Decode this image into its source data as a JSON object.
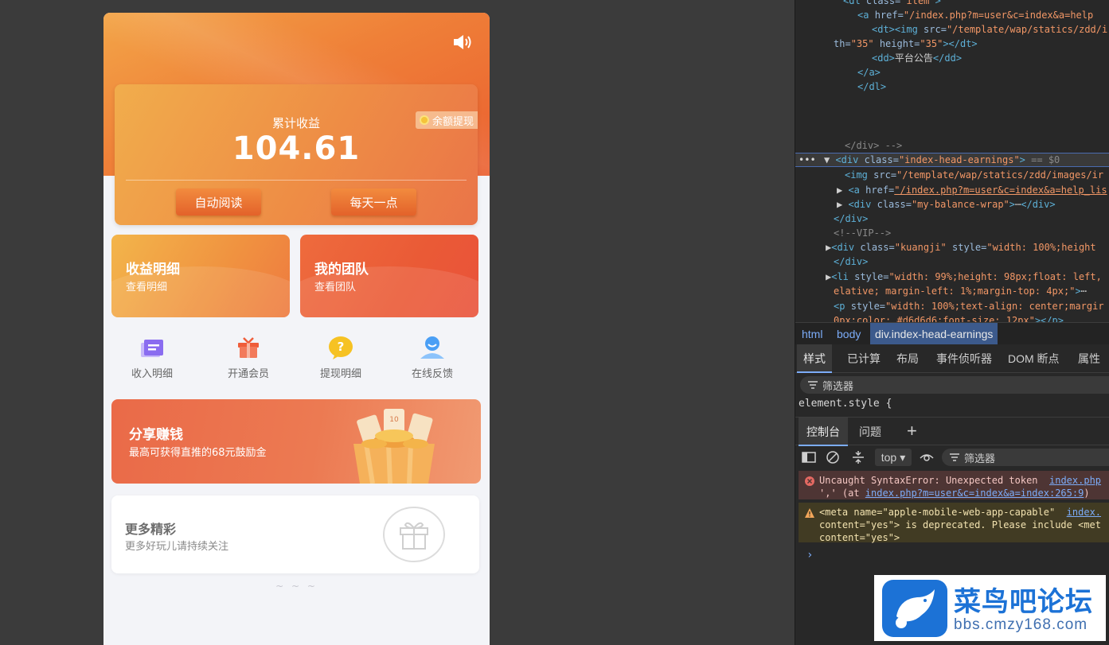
{
  "app": {
    "speaker_icon": "speaker-icon",
    "earnings": {
      "label": "累计收益",
      "value": "104.61",
      "withdraw_label": "余额提现"
    },
    "actions": [
      {
        "label": "自动阅读"
      },
      {
        "label": "每天一点"
      }
    ],
    "tiles": [
      {
        "title": "收益明细",
        "subtitle": "查看明细"
      },
      {
        "title": "我的团队",
        "subtitle": "查看团队"
      }
    ],
    "quick_links": [
      {
        "label": "收入明细",
        "icon": "document-icon",
        "color": "#8a6cf0"
      },
      {
        "label": "开通会员",
        "icon": "gift-box-icon",
        "color": "#ef5d3a"
      },
      {
        "label": "提现明细",
        "icon": "question-bubble-icon",
        "color": "#f6c223"
      },
      {
        "label": "在线反馈",
        "icon": "user-icon",
        "color": "#4a9ff5"
      }
    ],
    "share": {
      "title": "分享赚钱",
      "subtitle": "最高可获得直推的68元鼓励金",
      "ticket_label": "10"
    },
    "more": {
      "title": "更多精彩",
      "subtitle": "更多好玩儿请持续关注"
    },
    "footer_mark": "~ ~ ~"
  },
  "devtools": {
    "dom_lines": [
      {
        "indent": 60,
        "html": "<span class='tag'>&lt;dl</span> <span class='attr'>class=</span><span class='val'>\"item\"</span><span class='tag'>&gt;</span>"
      },
      {
        "indent": 78,
        "html": "<span class='tag'>&lt;a</span> <span class='attr'>href=</span><span class='val'>\"/index.php?m=user&amp;c=index&amp;a=help</span>"
      },
      {
        "indent": 96,
        "html": "<span class='tag'>&lt;dt&gt;&lt;img</span> <span class='attr'>src=</span><span class='val'>\"/template/wap/statics/zdd/i</span>"
      },
      {
        "indent": 48,
        "html": "<span class='attr'>th=</span><span class='val'>\"35\"</span> <span class='attr'>height=</span><span class='val'>\"35\"</span><span class='tag'>&gt;&lt;/dt&gt;</span>"
      },
      {
        "indent": 96,
        "html": "<span class='tag'>&lt;dd&gt;</span><span class='txt'>平台公告</span><span class='tag'>&lt;/dd&gt;</span>"
      },
      {
        "indent": 78,
        "html": "<span class='tag'>&lt;/a&gt;</span>"
      },
      {
        "indent": 78,
        "html": "<span class='tag'>&lt;/dl&gt;</span>"
      },
      {
        "indent": 62,
        "html": "<span class='cmt'>&lt;/div&gt; --&gt;</span>"
      },
      {
        "indent": 36,
        "html": "<span class='txt'>▼ </span><span class='tag'>&lt;div</span> <span class='attr'>class=</span><span class='val'>\"index-head-earnings\"</span><span class='tag'>&gt;</span> <span class='cmt'>== $0</span>"
      },
      {
        "indent": 62,
        "html": "<span class='tag'>&lt;img</span> <span class='attr'>src=</span><span class='val'>\"/template/wap/statics/zdd/images/ir</span>"
      },
      {
        "indent": 52,
        "html": "<span class='txt'>▶ </span><span class='tag'>&lt;a</span> <span class='attr'>href=</span><span class='link'>\"/index.php?m=user&amp;c=index&amp;a=help_lis</span>"
      },
      {
        "indent": 52,
        "html": "<span class='txt'>▶ </span><span class='tag'>&lt;div</span> <span class='attr'>class=</span><span class='val'>\"my-balance-wrap\"</span><span class='tag'>&gt;</span><span class='txt'>⋯</span><span class='tag'>&lt;/div&gt;</span>"
      },
      {
        "indent": 48,
        "html": "<span class='tag'>&lt;/div&gt;</span>"
      },
      {
        "indent": 48,
        "html": "<span class='cmt'>&lt;!--VIP--&gt;</span>"
      },
      {
        "indent": 38,
        "html": "<span class='txt'>▶</span><span class='tag'>&lt;div</span> <span class='attr'>class=</span><span class='val'>\"kuangji\"</span> <span class='attr'>style=</span><span class='val'>\"width: 100%;height</span>"
      },
      {
        "indent": 48,
        "html": "<span class='tag'>&lt;/div&gt;</span>"
      },
      {
        "indent": 38,
        "html": "<span class='txt'>▶</span><span class='tag'>&lt;li</span> <span class='attr'>style=</span><span class='val'>\"width: 99%;height: 98px;float: left,</span>"
      },
      {
        "indent": 48,
        "html": "<span class='val'>elative; margin-left: 1%;margin-top: 4px;\"</span><span class='tag'>&gt;</span><span class='txt'>⋯</span>"
      },
      {
        "indent": 48,
        "html": "<span class='tag'>&lt;p</span> <span class='attr'>style=</span><span class='val'>\"width: 100%;text-align: center;margir</span>"
      },
      {
        "indent": 48,
        "html": "<span class='val'>0px;color: #d6d6d6;font-size: 12px\"</span><span class='tag'>&gt;&lt;/p&gt;</span>"
      }
    ],
    "breadcrumbs": [
      "html",
      "body",
      "div.index-head-earnings"
    ],
    "panel_tabs": [
      "样式",
      "已计算",
      "布局",
      "事件侦听器",
      "DOM 断点",
      "属性"
    ],
    "filter_placeholder": "筛选器",
    "element_style": "element.style {",
    "console_tabs": [
      "控制台",
      "问题"
    ],
    "console_context": "top",
    "console_filter": "筛选器",
    "messages": [
      {
        "type": "error",
        "text1": "Uncaught SyntaxError: Unexpected token",
        "text2": "',' (at ",
        "link": "index.php?m=user&c=index&a=index:265:9",
        "text3": ")",
        "source": "index.php"
      },
      {
        "type": "warning",
        "text1": "<meta name=\"apple-mobile-web-app-capable\"",
        "text2": "content=\"yes\"> is deprecated. Please include <met",
        "text3": "content=\"yes\">",
        "source": "index."
      }
    ],
    "prompt": "›"
  },
  "watermark": {
    "title": "菜鸟吧论坛",
    "url": "bbs.cmzy168.com"
  }
}
